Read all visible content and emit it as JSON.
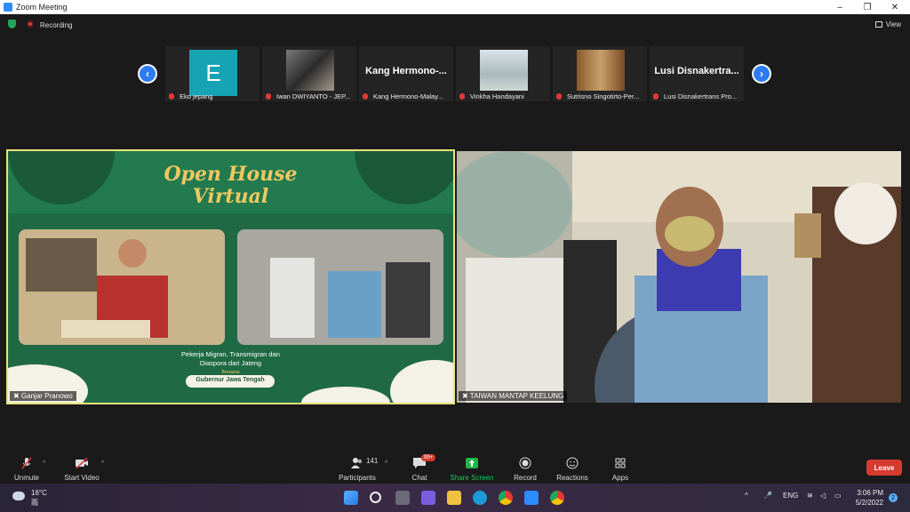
{
  "window": {
    "title": "Zoom Meeting",
    "controls": [
      "–",
      "❐",
      "✕"
    ]
  },
  "meeting": {
    "recording_label": "Recording",
    "view_label": "View"
  },
  "gallery": {
    "participants": [
      {
        "name": "Eko jepang",
        "avatar_letter": "E"
      },
      {
        "name": "Iwan DWIYANTO - JEP..."
      },
      {
        "name": "Kang Hermono-Malay...",
        "display_name": "Kang Hermono-..."
      },
      {
        "name": "Vinkha Handayani"
      },
      {
        "name": "Sutrisno Singotirto-Per..."
      },
      {
        "name": "Lusi Disnakertrans Pro...",
        "display_name": "Lusi Disnakertra..."
      }
    ],
    "prev_icon": "‹",
    "next_icon": "›"
  },
  "videos": {
    "left": {
      "name": "Ganjar Pranowo",
      "slide_title_1": "Open House",
      "slide_title_2": "Virtual",
      "slide_caption_1": "Pekerja Migran, Transmigran dan",
      "slide_caption_2": "Diaspora dari Jateng",
      "slide_small": "Bersama",
      "slide_tag": "Gubernur Jawa Tengah"
    },
    "right": {
      "name": "TAIWAN MANTAP KEELUNG"
    }
  },
  "toolbar": {
    "unmute": "Unmute",
    "start_video": "Start Video",
    "participants": "Participants",
    "participant_count": "141",
    "chat": "Chat",
    "chat_badge": "99+",
    "share_screen": "Share Screen",
    "record": "Record",
    "reactions": "Reactions",
    "apps": "Apps",
    "leave": "Leave"
  },
  "taskbar": {
    "weather_temp": "16°C",
    "weather_cond": "雨",
    "lang": "ENG",
    "time": "3:06 PM",
    "date": "5/2/2022",
    "notif_count": "2"
  }
}
